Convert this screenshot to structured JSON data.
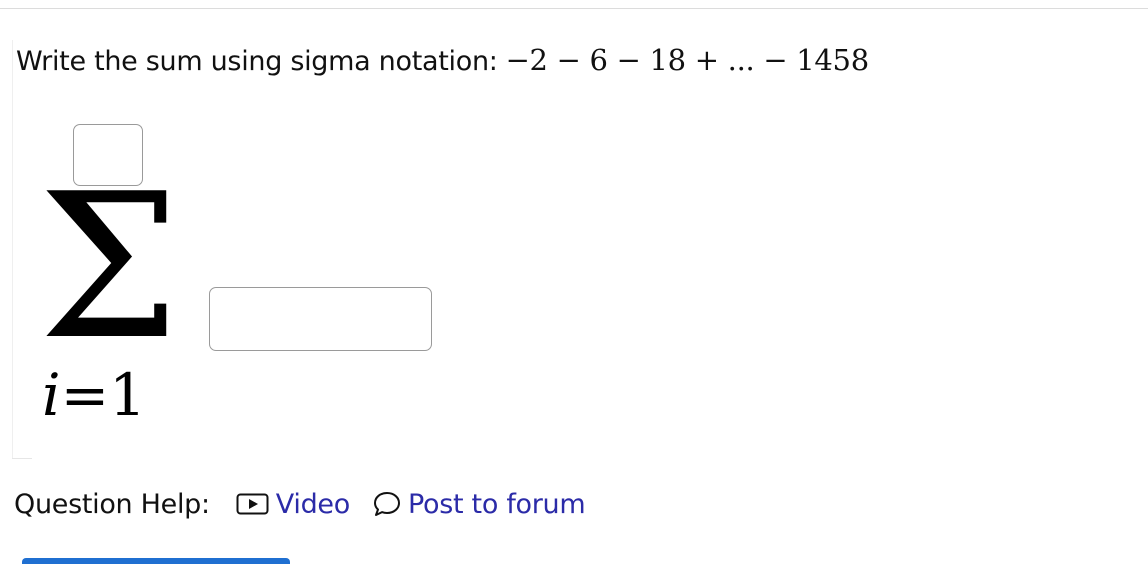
{
  "question": {
    "prompt": "Write the sum using sigma notation:",
    "expression": "−2 − 6 − 18 + ... − 1458"
  },
  "sigma": {
    "symbol": "Σ",
    "upper_limit_value": "",
    "term_value": "",
    "index_variable": "i",
    "equals": "=",
    "lower_limit": "1"
  },
  "help": {
    "label": "Question Help:",
    "video_label": "Video",
    "forum_label": "Post to forum",
    "video_icon": "play-video-icon",
    "forum_icon": "speech-bubble-icon"
  },
  "colors": {
    "link": "#2b2ba8",
    "button_accent": "#1f6fd1",
    "input_border": "#9a9a9a"
  }
}
